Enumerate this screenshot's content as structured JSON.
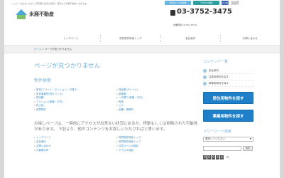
{
  "header": {
    "tagline": "ハッピーな住まいさがし!東京都大田区の賃貸・売買なら米鹿不動産にお任せを",
    "logo_text": "米鹿不動産",
    "buttons": [
      "住宅ローンの相談",
      "アクセス地図"
    ],
    "like_label": "いいね",
    "share_label": "シェア",
    "phone": "03-3752-3475",
    "hours": "営業時間 10:00〜18:00"
  },
  "nav": {
    "items": [
      "トップページ",
      "賃貸物件検索トップ",
      "会社案内",
      "お問い合わせ"
    ]
  },
  "breadcrumb": {
    "home": "ホーム",
    "sep": " » ",
    "current": "ページが見つかりません"
  },
  "main": {
    "title": "ページが見つかりません",
    "section_title": "物件検索",
    "links_left": [
      "賃貸(アパート・マンション・戸建て)",
      "賃貸事務所(貸オフィス)",
      "貸店舗",
      "マンション(新築・中古)",
      "貸土地",
      "売買物件"
    ],
    "links_right": [
      "貸倉庫(ガレージ)",
      "駐車場",
      "一戸建て(新築・中古)",
      "売地",
      "ビル",
      "店舗・事務所"
    ],
    "notice": "お探しページは、一時的にアクセスが出来ない状況にあるか、移動もしくは削除された可能性があります。 下記より、他のコンテンツをお探しいただければと思います。",
    "links2_left": [
      "トップページ",
      "会社案内",
      "お問い合わせ",
      "お客様の声"
    ],
    "links2_right": [
      "賃貸物件検索トップ",
      "売買物件検索トップ",
      "住宅ローンの相談",
      "アクセス地図"
    ]
  },
  "sidebar": {
    "title": "コンテンツ一覧",
    "items": [
      "会社案内",
      "住居用物件を探す",
      "事業用物件を探す"
    ],
    "banner1": "居住用物件を探す",
    "banner2": "事業用物件を探す",
    "free_word_title": "フリーワード検索",
    "select_value": "選択してください",
    "search_button": "検索",
    "counter_digits": [
      "0",
      "0",
      "0",
      "2",
      "4"
    ],
    "counter_unit": "件"
  }
}
